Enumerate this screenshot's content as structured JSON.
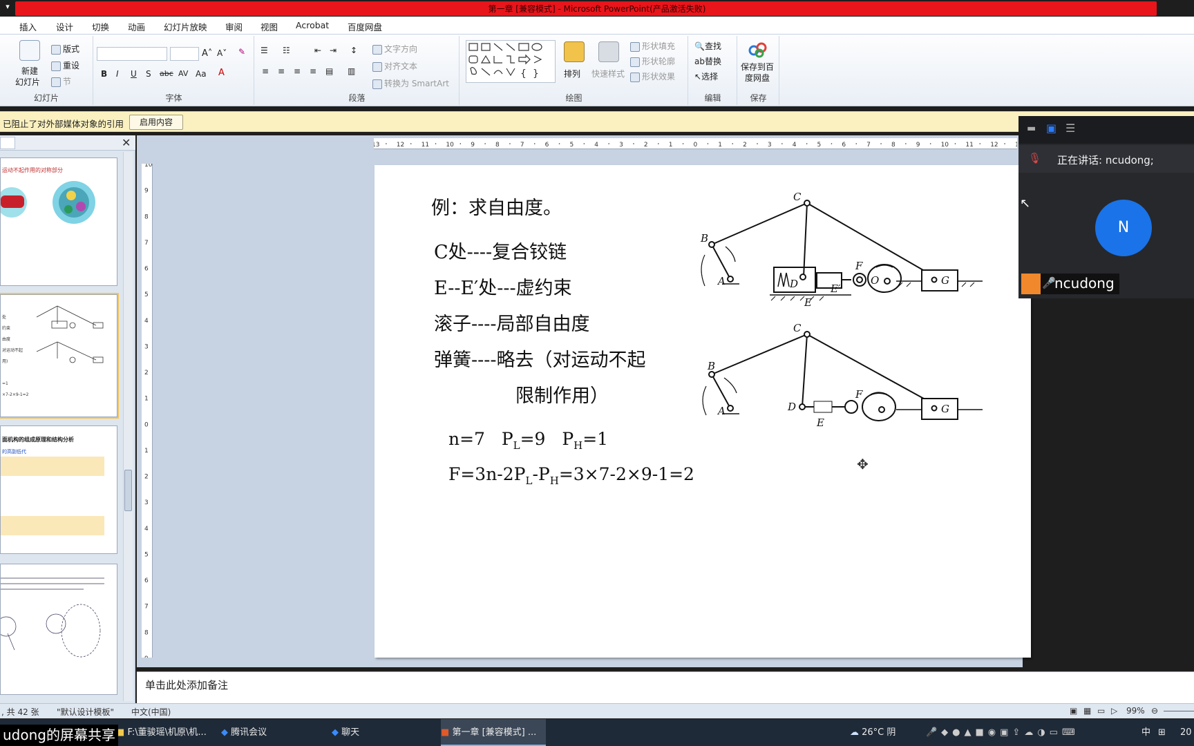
{
  "window": {
    "title": "第一章 [兼容模式] - Microsoft PowerPoint(产品激活失败)"
  },
  "ribbon_tabs": [
    "插入",
    "设计",
    "切换",
    "动画",
    "幻灯片放映",
    "审阅",
    "视图",
    "Acrobat",
    "百度网盘"
  ],
  "ribbon": {
    "slides": {
      "new_slide": "新建",
      "new_slide2": "幻灯片",
      "layout": "版式",
      "reset": "重设",
      "section": "节",
      "label": "幻灯片"
    },
    "font": {
      "label": "字体"
    },
    "paragraph": {
      "text_direction": "文字方向",
      "align_text": "对齐文本",
      "smartart": "转换为 SmartArt",
      "label": "段落"
    },
    "drawing": {
      "arrange": "排列",
      "quick_styles": "快速样式",
      "shape_fill": "形状填充",
      "shape_outline": "形状轮廓",
      "shape_effects": "形状效果",
      "label": "绘图"
    },
    "editing": {
      "find": "查找",
      "replace": "替换",
      "select": "选择",
      "label": "编辑"
    },
    "save": {
      "save_to": "保存到百",
      "save_to2": "度网盘",
      "label": "保存"
    }
  },
  "message_bar": {
    "text": "已阻止了对外部媒体对象的引用",
    "button": "启用内容"
  },
  "thumbs": {
    "t1_title": "运动不起作用的对称部分",
    "t3_title": "面机构的组成原理和结构分析",
    "t3_sub": "的高副低代"
  },
  "slide": {
    "title": "例：求自由度。",
    "line1": "C处----复合铰链",
    "line2": "E--E′处---虚约束",
    "line3": "滚子----局部自由度",
    "line4": "弹簧----略去（对运动不起",
    "line5": "限制作用）",
    "n_line": "n=7",
    "pl": "P",
    "pl_sub": "L",
    "pl_val": "=9",
    "ph": "P",
    "ph_sub": "H",
    "ph_val": "=1",
    "f_1": "F=3n-2P",
    "f_2": "-P",
    "f_3": "=3×7-2×9-1=2",
    "sub_L": "L",
    "sub_H": "H",
    "labels": {
      "A": "A",
      "B": "B",
      "C": "C",
      "D": "D",
      "E": "E",
      "E2": "E′",
      "F": "F",
      "G": "G",
      "O": "O"
    }
  },
  "notes": {
    "placeholder": "单击此处添加备注"
  },
  "status": {
    "slide_count": ", 共 42 张",
    "template": "\"默认设计模板\"",
    "language": "中文(中国)",
    "zoom": "99%"
  },
  "meeting": {
    "speaking": "正在讲话: ncudong;",
    "avatar_letter": "N",
    "name": "ncudong"
  },
  "taskbar": {
    "share_label": "udong的屏幕共享",
    "items": [
      "F:\\董骏瑶\\机原\\机...",
      "腾讯会议",
      "聊天",
      "第一章 [兼容模式] ..."
    ],
    "weather": "26°C 阴",
    "ime": "中",
    "clock": "20"
  }
}
